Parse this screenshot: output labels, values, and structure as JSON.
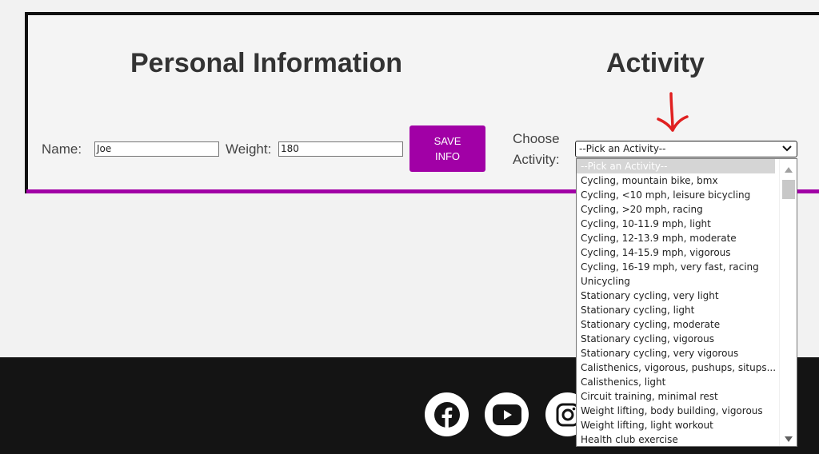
{
  "personal": {
    "heading": "Personal Information",
    "name_label": "Name:",
    "name_value": "Joe",
    "weight_label": "Weight:",
    "weight_value": "180",
    "save_line1": "SAVE",
    "save_line2": "INFO"
  },
  "activity": {
    "heading": "Activity",
    "choose_label_line1": "Choose",
    "choose_label_line2": "Activity:",
    "selected_value": "--Pick an Activity--",
    "options": [
      "--Pick an Activity--",
      "Cycling, mountain bike, bmx",
      "Cycling, <10 mph, leisure bicycling",
      "Cycling, >20 mph, racing",
      "Cycling, 10-11.9 mph, light",
      "Cycling, 12-13.9 mph, moderate",
      "Cycling, 14-15.9 mph, vigorous",
      "Cycling, 16-19 mph, very fast, racing",
      "Unicycling",
      "Stationary cycling, very light",
      "Stationary cycling, light",
      "Stationary cycling, moderate",
      "Stationary cycling, vigorous",
      "Stationary cycling, very vigorous",
      "Calisthenics, vigorous, pushups, situps...",
      "Calisthenics, light",
      "Circuit training, minimal rest",
      "Weight lifting, body building, vigorous",
      "Weight lifting, light workout",
      "Health club exercise"
    ]
  },
  "footer": {
    "social_icons": [
      "facebook-icon",
      "youtube-icon",
      "instagram-icon"
    ]
  },
  "colors": {
    "accent": "#a100a6",
    "annotation_arrow": "#e02020",
    "footer_bg": "#141414"
  }
}
